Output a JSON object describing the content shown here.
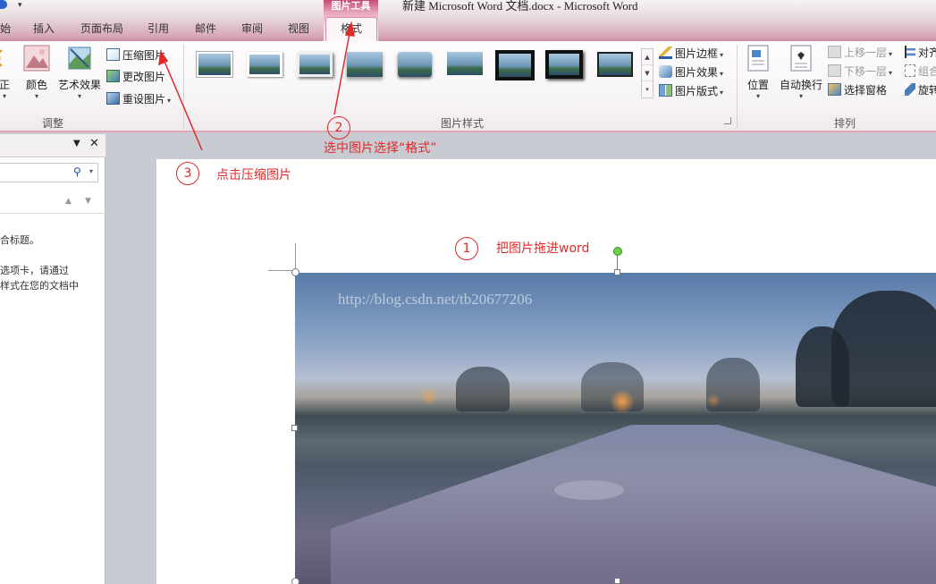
{
  "window": {
    "title": "新建 Microsoft Word 文档.docx  -  Microsoft Word",
    "contextual_group": "图片工具"
  },
  "tabs": [
    {
      "label": "始"
    },
    {
      "label": "插入"
    },
    {
      "label": "页面布局"
    },
    {
      "label": "引用"
    },
    {
      "label": "邮件"
    },
    {
      "label": "审阅"
    },
    {
      "label": "视图"
    },
    {
      "label": "格式",
      "active": true
    }
  ],
  "ribbon": {
    "adjust": {
      "group_label": "调整",
      "correct_label": "正",
      "color_label": "颜色",
      "artistic_label": "艺术效果",
      "compress_label": "压缩图片",
      "change_label": "更改图片",
      "reset_label": "重设图片"
    },
    "picture_styles": {
      "group_label": "图片样式",
      "border_label": "图片边框",
      "effects_label": "图片效果",
      "layout_label": "图片版式"
    },
    "arrange": {
      "group_label": "排列",
      "position_label": "位置",
      "wrap_label": "自动换行",
      "bring_forward_label": "上移一层",
      "send_backward_label": "下移一层",
      "selection_pane_label": "选择窗格",
      "align_label": "对齐",
      "group_btn_label": "组合",
      "rotate_label": "旋转"
    }
  },
  "nav_pane": {
    "text_lines": [
      "合标题。",
      "选项卡，请通过",
      "样式在您的文档中"
    ]
  },
  "document": {
    "watermark": "http://blog.csdn.net/tb20677206"
  },
  "annotations": {
    "step1_number": "1",
    "step1_text": "把图片拖进word",
    "step2_number": "2",
    "step2_text": "选中图片选择“格式”",
    "step3_number": "3",
    "step3_text": "点击压缩图片"
  },
  "colors": {
    "annotation_red": "#e02a2a",
    "contextual_pink": "#c44b72",
    "rotate_handle_green": "#6ed14a"
  }
}
